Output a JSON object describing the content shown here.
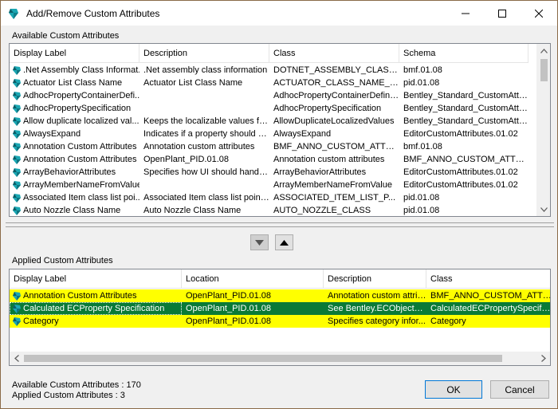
{
  "window": {
    "title": "Add/Remove Custom Attributes"
  },
  "available": {
    "group_label": "Available Custom Attributes",
    "columns": [
      "Display Label",
      "Description",
      "Class",
      "Schema"
    ],
    "rows": [
      [
        ".Net Assembly Class Informat...",
        ".Net assembly class information",
        "DOTNET_ASSEMBLY_CLASS...",
        "bmf.01.08"
      ],
      [
        "Actuator List Class Name",
        "Actuator List Class Name",
        "ACTUATOR_CLASS_NAME_L...",
        "pid.01.08"
      ],
      [
        "AdhocPropertyContainerDefi...",
        "",
        "AdhocPropertyContainerDefiniti...",
        "Bentley_Standard_CustomAttrib..."
      ],
      [
        "AdhocPropertySpecification",
        "",
        "AdhocPropertySpecification",
        "Bentley_Standard_CustomAttrib..."
      ],
      [
        "Allow duplicate localized val...",
        "Keeps the localizable values fro...",
        "AllowDuplicateLocalizedValues",
        "Bentley_Standard_CustomAttrib..."
      ],
      [
        "AlwaysExpand",
        "Indicates if a property should al...",
        "AlwaysExpand",
        "EditorCustomAttributes.01.02"
      ],
      [
        "Annotation Custom Attributes",
        "Annotation custom attributes",
        "BMF_ANNO_CUSTOM_ATTRI...",
        "bmf.01.08"
      ],
      [
        "Annotation Custom Attributes",
        "OpenPlant_PID.01.08",
        "Annotation custom attributes",
        "BMF_ANNO_CUSTOM_ATTRI..."
      ],
      [
        "ArrayBehaviorAttributes",
        "Specifies how UI should handle...",
        "ArrayBehaviorAttributes",
        "EditorCustomAttributes.01.02"
      ],
      [
        "ArrayMemberNameFromValue",
        "",
        "ArrayMemberNameFromValue",
        "EditorCustomAttributes.01.02"
      ],
      [
        "Associated Item class list poi...",
        "Associated Item class list pointer",
        "ASSOCIATED_ITEM_LIST_P...",
        "pid.01.08"
      ],
      [
        "Auto Nozzle Class Name",
        "Auto Nozzle Class Name",
        "AUTO_NOZZLE_CLASS",
        "pid.01.08"
      ]
    ]
  },
  "applied": {
    "group_label": "Applied Custom Attributes",
    "columns": [
      "Display Label",
      "Location",
      "Description",
      "Class"
    ],
    "rows": [
      [
        "Annotation Custom Attributes",
        "OpenPlant_PID.01.08",
        "Annotation custom attrib...",
        "BMF_ANNO_CUSTOM_ATTRIB"
      ],
      [
        "Calculated ECProperty Specification",
        "OpenPlant_PID.01.08",
        "See Bentley.ECObjects....",
        "CalculatedECPropertySpecificatio"
      ],
      [
        "Category",
        "OpenPlant_PID.01.08",
        "Specifies category infor...",
        "Category"
      ]
    ]
  },
  "status": {
    "available_count": "Available Custom Attributes : 170",
    "applied_count": "Applied Custom Attributes : 3"
  },
  "buttons": {
    "ok": "OK",
    "cancel": "Cancel"
  },
  "colors": {
    "highlight": "#ffff00",
    "selected": "#0a7a37",
    "gem": "#1aa7b3"
  },
  "icons": {
    "row_icon": "schema-gem-icon",
    "app_icon": "app-gem-icon"
  }
}
